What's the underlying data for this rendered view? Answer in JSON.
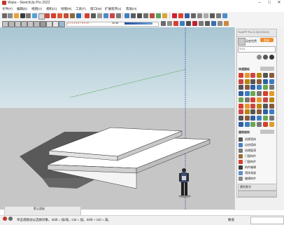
{
  "window": {
    "title": "Wuke - SketchUp Pro 2022",
    "controls": [
      "–",
      "□",
      "✕"
    ]
  },
  "menu": [
    "文件(F)",
    "编辑(E)",
    "视图(V)",
    "相机(C)",
    "绘图(R)",
    "工具(T)",
    "窗口(W)",
    "扩展程序(x)",
    "帮助(H)"
  ],
  "toolbar": {
    "scale_numbers": "1 2 3 4 5 6 7 8 9 10",
    "value_display": "30.58"
  },
  "panel": {
    "plugin_title": "SUAPP Pro 3.3(0.09410)",
    "account_label": "深度免费",
    "login_btn": "登录",
    "search_value": "0001",
    "section_common": "快速图标",
    "section_list": "建筑结构",
    "list_items": [
      "创建墙体",
      "自由墙体",
      "创建窗洞",
      "门窗构件",
      "门窗构件",
      "构件编辑",
      "墙体高度",
      "编辑构件"
    ],
    "bottom_label": "属性数字"
  },
  "tray": {
    "title": "默认面板"
  },
  "status": {
    "text": "单击或拖动以选择对象。Shift = 加/减。Ctrl = 加。Shift + Ctrl = 减。",
    "measure_label": "数值",
    "measure_value": ""
  },
  "colors": {
    "sky": "#bcd4de",
    "ground": "#c6c6c6",
    "slab": "#ffffff",
    "shadow": "#585858",
    "accent_red": "#d6322b"
  }
}
